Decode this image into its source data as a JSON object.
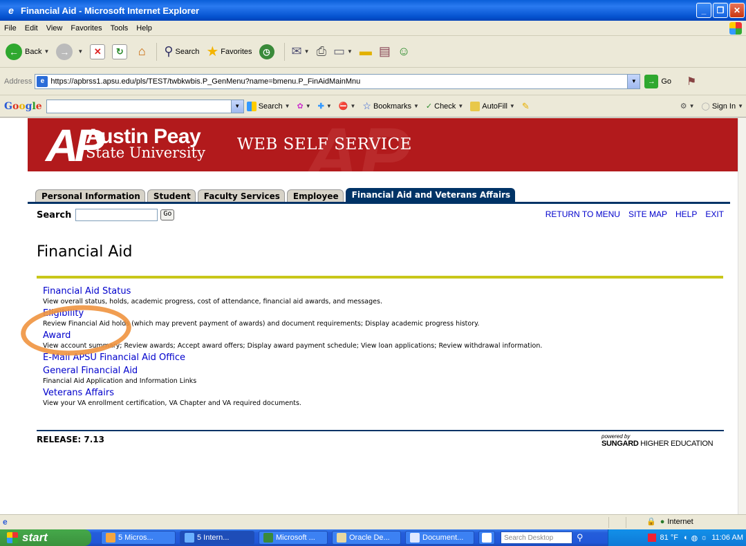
{
  "window": {
    "title": "Financial Aid - Microsoft Internet Explorer",
    "buttons": [
      "_",
      "❐",
      "✕"
    ]
  },
  "menubar": [
    "File",
    "Edit",
    "View",
    "Favorites",
    "Tools",
    "Help"
  ],
  "toolbar": {
    "back": "Back",
    "search": "Search",
    "favorites": "Favorites"
  },
  "address": {
    "label": "Address",
    "url": "https://apbrss1.apsu.edu/pls/TEST/twbkwbis.P_GenMenu?name=bmenu.P_FinAidMainMnu",
    "go": "Go"
  },
  "googlebar": {
    "logo": [
      "G",
      "o",
      "o",
      "g",
      "l",
      "e"
    ],
    "search": "Search",
    "bookmarks": "Bookmarks",
    "check": "Check",
    "autofill": "AutoFill",
    "signin": "Sign In"
  },
  "banner": {
    "logo": "AP",
    "name": "Austin Peay",
    "sub": "State University",
    "service": "WEB SELF SERVICE"
  },
  "tabs": [
    {
      "label": "Personal Information",
      "active": false
    },
    {
      "label": "Student",
      "active": false
    },
    {
      "label": "Faculty Services",
      "active": false
    },
    {
      "label": "Employee",
      "active": false
    },
    {
      "label": "Financial Aid and Veterans Affairs",
      "active": true
    }
  ],
  "search": {
    "label": "Search",
    "go": "Go"
  },
  "toplinks": [
    "RETURN TO MENU",
    "SITE MAP",
    "HELP",
    "EXIT"
  ],
  "page_title": "Financial Aid",
  "menu": [
    {
      "link": "Financial Aid Status",
      "desc": "View overall status, holds, academic progress, cost of attendance, financial aid awards, and messages."
    },
    {
      "link": "Eligibility",
      "desc": "Review Financial Aid holds (which may prevent payment of awards) and document requirements; Display academic progress history."
    },
    {
      "link": "Award",
      "desc": "View account summary; Review awards; Accept award offers; Display award payment schedule; View loan applications; Review withdrawal information."
    },
    {
      "link": "E-Mail APSU Financial Aid Office",
      "desc": ""
    },
    {
      "link": "General Financial Aid",
      "desc": "Financial Aid Application and Information Links"
    },
    {
      "link": "Veterans Affairs",
      "desc": "View your VA enrollment certification, VA Chapter and VA required documents."
    }
  ],
  "footer": {
    "release": "RELEASE: 7.13",
    "powered": "powered by",
    "sungard_bold": "SUNGARD",
    "sungard_rest": " HIGHER EDUCATION"
  },
  "statusbar": {
    "zone": "Internet"
  },
  "taskbar": {
    "start": "start",
    "tasks": [
      "5 Micros...",
      "5 Intern...",
      "Microsoft ...",
      "Oracle De...",
      "Document..."
    ],
    "search_placeholder": "Search Desktop",
    "temp": "81 °F",
    "time": "11:06 AM"
  }
}
